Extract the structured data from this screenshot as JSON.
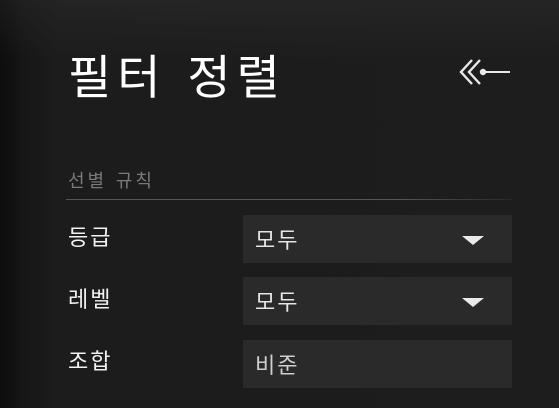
{
  "header": {
    "title": "필터 정렬",
    "back_icon": "double-chevron-left-arrow-icon"
  },
  "filter": {
    "section_label": "선별 규칙",
    "rows": [
      {
        "label": "등급",
        "value": "모두",
        "type": "dropdown"
      },
      {
        "label": "레벨",
        "value": "모두",
        "type": "dropdown"
      },
      {
        "label": "조합",
        "value": "비준",
        "type": "field"
      }
    ]
  },
  "colors": {
    "background": "#1d1d1d",
    "field_background": "#2a2a2a",
    "text": "#ffffff",
    "muted_text": "#7a7a7a",
    "divider": "#555555"
  }
}
